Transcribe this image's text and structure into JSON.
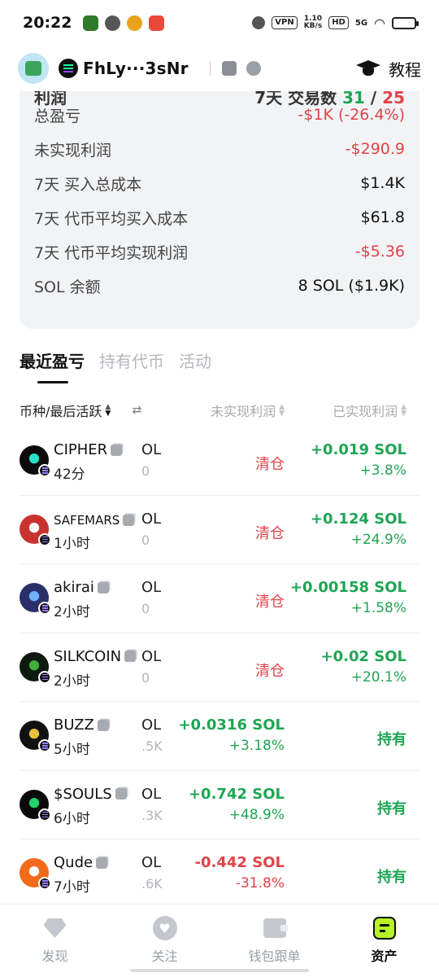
{
  "status_bar": {
    "time": "20:22",
    "vpn": "VPN",
    "speed_value": "1.10",
    "speed_unit": "KB/s",
    "hd": "HD",
    "network": "5G"
  },
  "header": {
    "wallet_name": "FhLy···3sNr",
    "tutorial_label": "教程"
  },
  "stats": {
    "cut_row": {
      "label": "利润",
      "right_prefix": "7天 交易数",
      "buys": "31",
      "sep": "/",
      "sells": "25"
    },
    "rows": [
      {
        "label": "总盈亏",
        "value": "-$1K (-26.4%)",
        "tone": "neg"
      },
      {
        "label": "未实现利润",
        "value": "-$290.9",
        "tone": "neg"
      },
      {
        "label": "7天 买入总成本",
        "value": "$1.4K",
        "tone": "plain"
      },
      {
        "label": "7天 代币平均买入成本",
        "value": "$61.8",
        "tone": "plain"
      },
      {
        "label": "7天 代币平均实现利润",
        "value": "-$5.36",
        "tone": "neg"
      },
      {
        "label": "SOL 余额",
        "value": "8 SOL ($1.9K)",
        "tone": "plain"
      }
    ]
  },
  "tabs": [
    {
      "label": "最近盈亏",
      "active": true
    },
    {
      "label": "持有代币",
      "active": false
    },
    {
      "label": "活动",
      "active": false
    }
  ],
  "table_header": {
    "token_col": "币种/最后活跃",
    "unrealized_col": "未实现利润",
    "realized_col": "已实现利润"
  },
  "rows": [
    {
      "name": "CIPHER",
      "time": "42分",
      "ol": "OL",
      "ol_value": "0",
      "unreal_status": "清仓",
      "unreal_sol": "",
      "unreal_pct": "",
      "unreal_tone": "",
      "real_sol": "+0.019 SOL",
      "real_pct": "+3.8%",
      "hold_label": "",
      "name_small": false,
      "coin_color": "#0b0b0b",
      "coin_accent": "#27e0c8"
    },
    {
      "name": "SAFEMARS",
      "time": "1小时",
      "ol": "OL",
      "ol_value": "0",
      "unreal_status": "清仓",
      "unreal_sol": "",
      "unreal_pct": "",
      "unreal_tone": "",
      "real_sol": "+0.124 SOL",
      "real_pct": "+24.9%",
      "hold_label": "",
      "name_small": true,
      "coin_color": "#c8332f",
      "coin_accent": "#ffffff"
    },
    {
      "name": "akirai",
      "time": "2小时",
      "ol": "OL",
      "ol_value": "0",
      "unreal_status": "清仓",
      "unreal_sol": "",
      "unreal_pct": "",
      "unreal_tone": "",
      "real_sol": "+0.00158 SOL",
      "real_pct": "+1.58%",
      "hold_label": "",
      "name_small": false,
      "coin_color": "#2a2f6a",
      "coin_accent": "#6fb0ff"
    },
    {
      "name": "SILKCOIN",
      "time": "2小时",
      "ol": "OL",
      "ol_value": "0",
      "unreal_status": "清仓",
      "unreal_sol": "",
      "unreal_pct": "",
      "unreal_tone": "",
      "real_sol": "+0.02 SOL",
      "real_pct": "+20.1%",
      "hold_label": "",
      "name_small": false,
      "coin_color": "#0d1a0d",
      "coin_accent": "#3fae3a"
    },
    {
      "name": "BUZZ",
      "time": "5小时",
      "ol": "OL",
      "ol_value": ".5K",
      "unreal_status": "",
      "unreal_sol": "+0.0316 SOL",
      "unreal_pct": "+3.18%",
      "unreal_tone": "pos",
      "real_sol": "",
      "real_pct": "",
      "hold_label": "持有",
      "name_small": false,
      "coin_color": "#111111",
      "coin_accent": "#e6c33a"
    },
    {
      "name": "$SOULS",
      "time": "6小时",
      "ol": "OL",
      "ol_value": ".3K",
      "unreal_status": "",
      "unreal_sol": "+0.742 SOL",
      "unreal_pct": "+48.9%",
      "unreal_tone": "pos",
      "real_sol": "",
      "real_pct": "",
      "hold_label": "持有",
      "name_small": false,
      "coin_color": "#0a0a0a",
      "coin_accent": "#22d46a"
    },
    {
      "name": "Qude",
      "time": "7小时",
      "ol": "OL",
      "ol_value": ".6K",
      "unreal_status": "",
      "unreal_sol": "-0.442 SOL",
      "unreal_pct": "-31.8%",
      "unreal_tone": "neg",
      "real_sol": "",
      "real_pct": "",
      "hold_label": "持有",
      "name_small": false,
      "coin_color": "#f26a1b",
      "coin_accent": "#ffffff"
    }
  ],
  "bottom_nav": [
    {
      "label": "发现",
      "icon": "diamond-icon",
      "active": false
    },
    {
      "label": "关注",
      "icon": "heart-icon",
      "active": false
    },
    {
      "label": "钱包跟单",
      "icon": "wallet-icon",
      "active": false
    },
    {
      "label": "资产",
      "icon": "assets-icon",
      "active": true
    }
  ],
  "colors": {
    "positive": "#1fa554",
    "negative": "#e0434a",
    "accent": "#b6f224"
  }
}
